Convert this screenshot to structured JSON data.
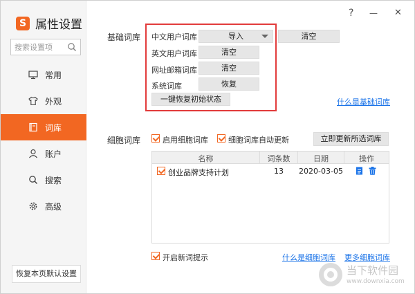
{
  "app": {
    "logo_letter": "S",
    "title": "属性设置"
  },
  "titlebar": {
    "help": "?",
    "minimize": "—",
    "close": "✕"
  },
  "search": {
    "placeholder": "搜索设置项"
  },
  "sidebar": {
    "items": [
      {
        "label": "常用",
        "icon": "monitor-icon",
        "active": false
      },
      {
        "label": "外观",
        "icon": "shirt-icon",
        "active": false
      },
      {
        "label": "词库",
        "icon": "book-icon",
        "active": true
      },
      {
        "label": "账户",
        "icon": "user-icon",
        "active": false
      },
      {
        "label": "搜索",
        "icon": "search-icon",
        "active": false
      },
      {
        "label": "高级",
        "icon": "gear-icon",
        "active": false
      }
    ],
    "reset_label": "恢复本页默认设置"
  },
  "basic": {
    "section_label": "基础词库",
    "rows": [
      {
        "label": "中文用户词库",
        "button": "导入",
        "extra_button": "清空"
      },
      {
        "label": "英文用户词库",
        "button": "清空"
      },
      {
        "label": "网址邮箱词库",
        "button": "清空"
      },
      {
        "label": "系统词库",
        "button": "恢复"
      }
    ],
    "restore_all": "一键恢复初始状态",
    "help_link": "什么是基础词库"
  },
  "cell": {
    "section_label": "细胞词库",
    "enable_label": "启用细胞词库",
    "auto_update_label": "细胞词库自动更新",
    "update_button": "立即更新所选词库",
    "table": {
      "headers": [
        "名称",
        "词条数",
        "日期",
        "操作"
      ],
      "rows": [
        {
          "name": "创业品牌支持计划",
          "count": "13",
          "date": "2020-03-05"
        }
      ]
    },
    "new_word_label": "开启新词提示",
    "what_link": "什么是细胞词库",
    "more_link": "更多细胞词库"
  },
  "watermark": {
    "cn": "当下软件园",
    "en": "www.downxia.com"
  },
  "colors": {
    "accent": "#f26722",
    "highlight": "#e23b3b",
    "link": "#1a73e8"
  }
}
